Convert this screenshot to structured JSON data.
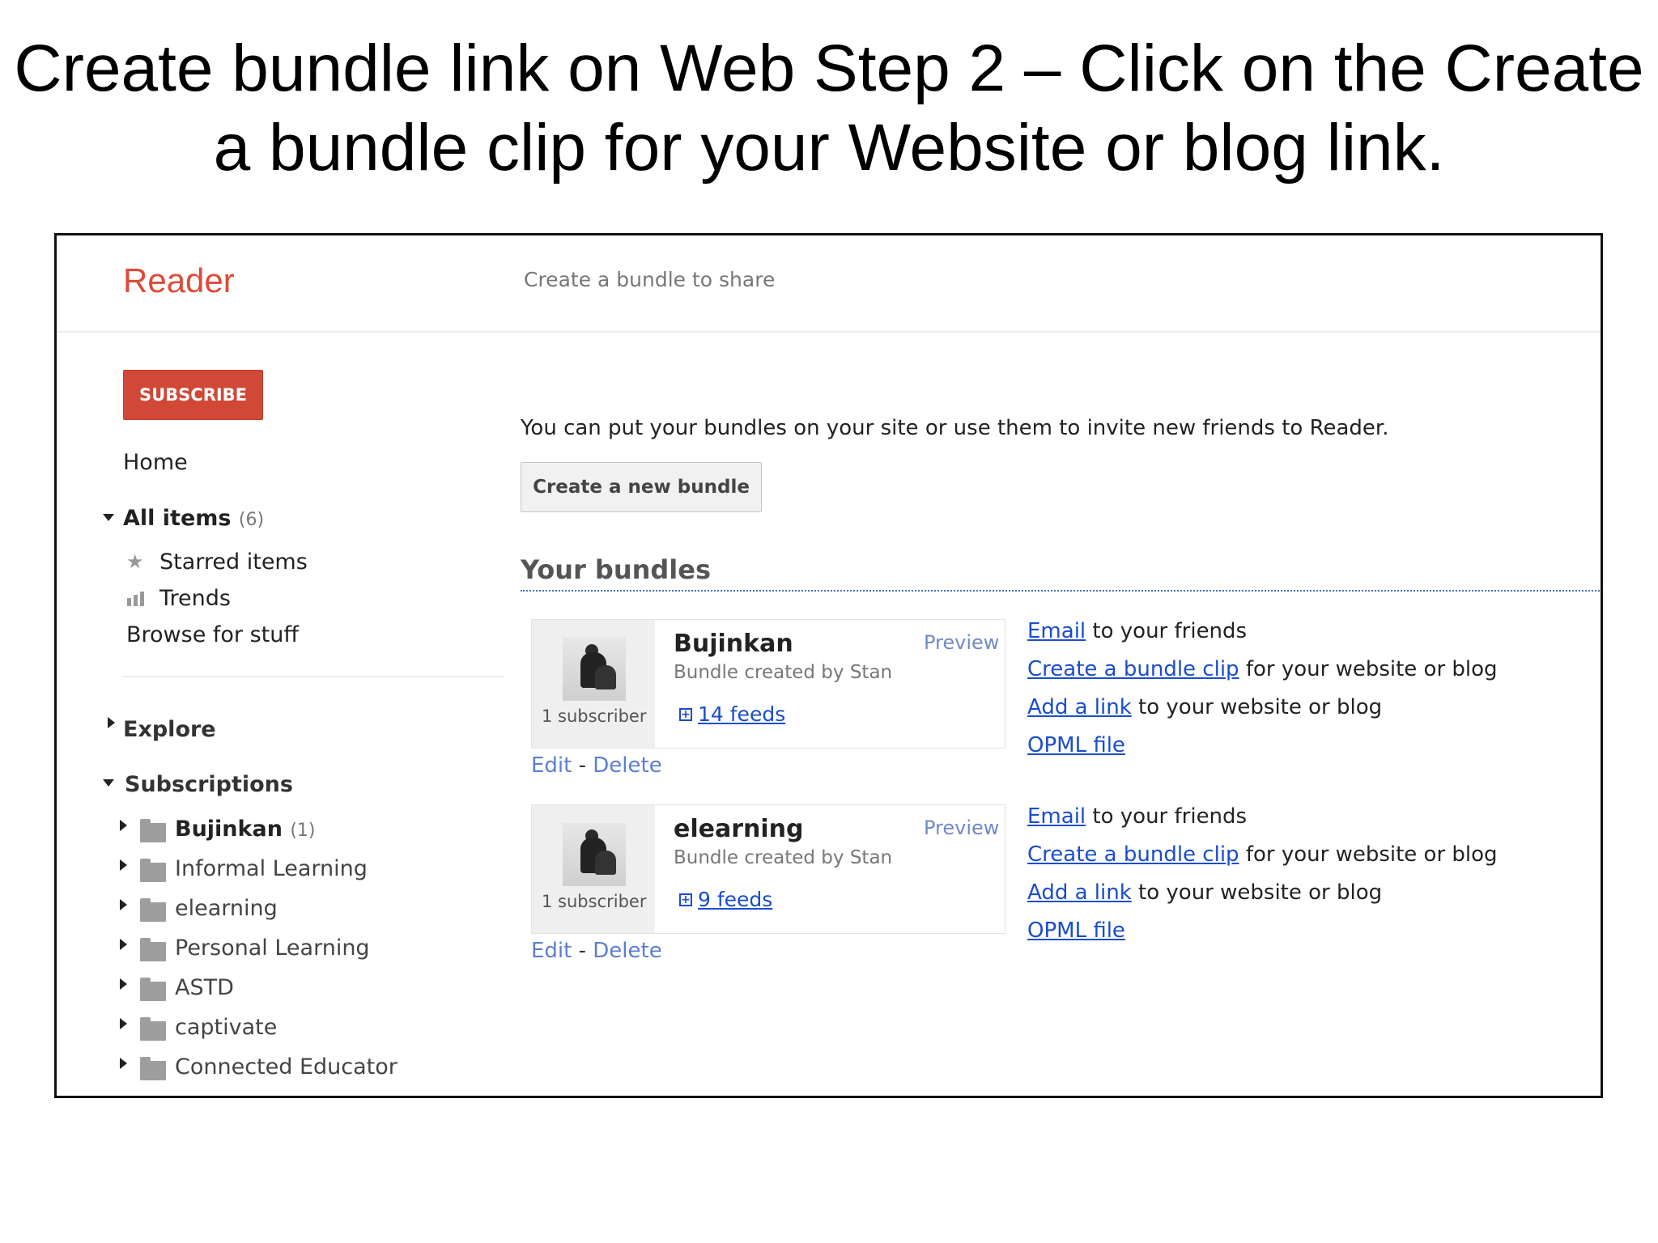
{
  "slide": {
    "title_line1": "Create bundle link on Web Step 2 – Click on the Create",
    "title_line2": "a bundle clip for your Website or blog link."
  },
  "header": {
    "logo": "Reader",
    "crumb": "Create a bundle to share"
  },
  "sidebar": {
    "subscribe_label": "SUBSCRIBE",
    "home": "Home",
    "all_items": {
      "label": "All items",
      "count": "(6)"
    },
    "starred": "Starred items",
    "trends": "Trends",
    "browse": "Browse for stuff",
    "explore": "Explore",
    "subscriptions": "Subscriptions",
    "folders": [
      {
        "label": "Bujinkan",
        "count": "(1)",
        "bold": true
      },
      {
        "label": "Informal Learning"
      },
      {
        "label": "elearning"
      },
      {
        "label": "Personal Learning"
      },
      {
        "label": "ASTD"
      },
      {
        "label": "captivate"
      },
      {
        "label": "Connected Educator"
      }
    ]
  },
  "main": {
    "intro": "You can put your bundles on your site or use them to invite new friends to Reader.",
    "new_bundle_label": "Create a new bundle",
    "section_title": "Your bundles",
    "bundles": [
      {
        "name": "Bujinkan",
        "created_by": "Bundle created by Stan",
        "preview": "Preview",
        "subscribers": "1 subscriber",
        "feeds": "14 feeds",
        "edit": "Edit",
        "sep": "-",
        "delete": "Delete"
      },
      {
        "name": "elearning",
        "created_by": "Bundle created by Stan",
        "preview": "Preview",
        "subscribers": "1 subscriber",
        "feeds": "9 feeds",
        "edit": "Edit",
        "sep": "-",
        "delete": "Delete"
      }
    ],
    "actions": {
      "email_link": "Email",
      "email_rest": " to your friends",
      "clip_link": "Create a bundle clip",
      "clip_rest": " for your website or blog",
      "addlink_link": "Add a link",
      "addlink_rest": " to your website or blog",
      "opml_link": "OPML file"
    }
  },
  "colors": {
    "logo": "#dd4b39",
    "subscribe": "#d14836",
    "link": "#1a4dcc"
  }
}
